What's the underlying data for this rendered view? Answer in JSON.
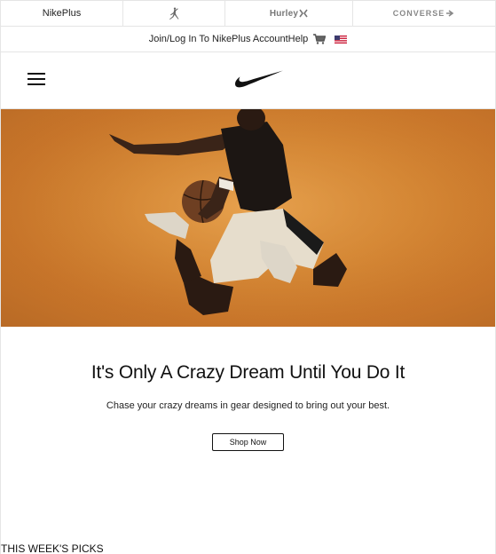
{
  "brand_bar": {
    "nikeplus_label": "NikePlus",
    "hurley_label": "Hurley",
    "converse_label": "CONVERSE"
  },
  "utility_bar": {
    "join_link": "Join/Log In To NikePlus Account",
    "help_link": "Help"
  },
  "icons": {
    "jordan": "jumpman-icon",
    "cart": "cart-icon",
    "flag": "us-flag-icon",
    "menu": "hamburger-menu-icon",
    "logo": "nike-swoosh-icon"
  },
  "hero": {
    "background_color": "#d98a35"
  },
  "promo": {
    "title": "It's Only A Crazy Dream Until You Do It",
    "subtitle": "Chase your crazy dreams in gear designed to bring out your best.",
    "cta_label": "Shop Now"
  },
  "picks": {
    "heading": "THIS WEEK'S PICKS"
  }
}
